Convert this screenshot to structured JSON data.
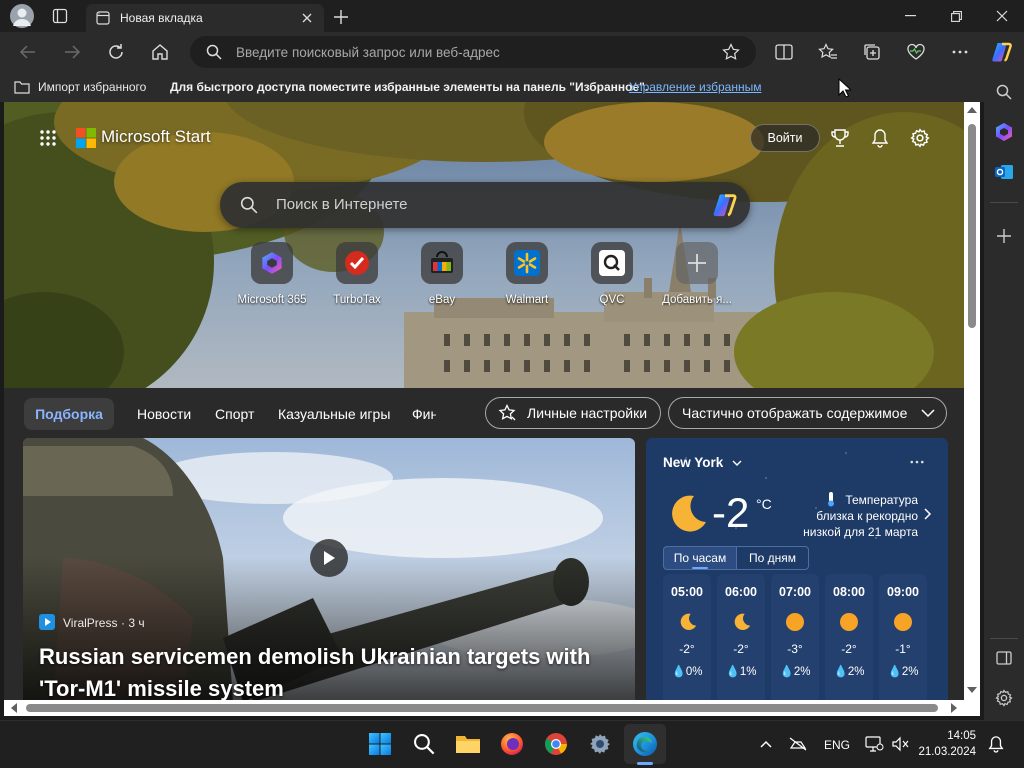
{
  "browser": {
    "tab_title": "Новая вкладка",
    "address_placeholder": "Введите поисковый запрос или веб-адрес",
    "favorites": {
      "import_label": "Импорт избранного",
      "hint": "Для быстрого доступа поместите избранные элементы на панель \"Избранное\".",
      "manage_link": "Управление избранным"
    }
  },
  "start": {
    "brand": "Microsoft Start",
    "signin_label": "Войти",
    "search_placeholder": "Поиск в Интернете",
    "shortcuts": [
      {
        "label": "Microsoft 365",
        "icon": "microsoft-365-icon"
      },
      {
        "label": "TurboTax",
        "icon": "turbotax-icon"
      },
      {
        "label": "eBay",
        "icon": "ebay-icon"
      },
      {
        "label": "Walmart",
        "icon": "walmart-icon"
      },
      {
        "label": "QVC",
        "icon": "qvc-icon"
      },
      {
        "label": "Добавить я...",
        "icon": "plus-icon"
      }
    ],
    "nav_tabs": [
      "Подборка",
      "Новости",
      "Спорт",
      "Казуальные игры",
      "Фин"
    ],
    "personalize_label": "Личные настройки",
    "content_mode": "Частично отображать содержимое",
    "article": {
      "source": "ViralPress",
      "age": "· 3 ч",
      "title_line1": "Russian servicemen demolish Ukrainian targets with",
      "title_line2": "'Tor-M1' missile system"
    },
    "weather": {
      "location": "New York",
      "temperature": "-2",
      "unit": "°C",
      "alert_line1": "Температура",
      "alert_line2": "близка к рекордно",
      "alert_line3": "низкой для 21 марта",
      "tab_hourly": "По часам",
      "tab_daily": "По дням",
      "hours": [
        {
          "time": "05:00",
          "icon": "moon-icon",
          "temp": "-2°",
          "precip": "0%"
        },
        {
          "time": "06:00",
          "icon": "moon-icon",
          "temp": "-2°",
          "precip": "1%"
        },
        {
          "time": "07:00",
          "icon": "sun-icon",
          "temp": "-3°",
          "precip": "2%"
        },
        {
          "time": "08:00",
          "icon": "sun-icon",
          "temp": "-2°",
          "precip": "2%"
        },
        {
          "time": "09:00",
          "icon": "sun-icon",
          "temp": "-1°",
          "precip": "2%"
        }
      ]
    }
  },
  "taskbar": {
    "language": "ENG",
    "time": "14:05",
    "date": "21.03.2024"
  },
  "colors": {
    "accent": "#6ea8ff",
    "weather_card": "#1e3a66",
    "link": "#79b8ff"
  }
}
